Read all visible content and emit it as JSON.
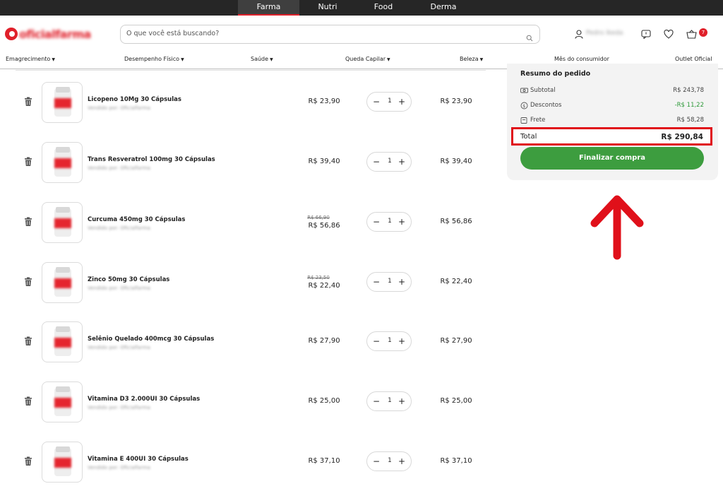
{
  "top_tabs": [
    "Farma",
    "Nutri",
    "Food",
    "Derma"
  ],
  "active_tab": "Farma",
  "logo_text": "oficialfarma",
  "search": {
    "placeholder": "O que você está buscando?"
  },
  "user_name": "Pedro Ikeda",
  "cart_count": "7",
  "categories": [
    "Emagrecimento",
    "Desempenho Físico",
    "Saúde",
    "Queda Capilar",
    "Beleza",
    "Mês do consumidor",
    "Outlet Oficial"
  ],
  "seller_text": "Vendido por: Oficialfarma",
  "items": [
    {
      "name": "Licopeno 10Mg 30 Cápsulas",
      "old_price": "",
      "price": "R$ 23,90",
      "qty": "1",
      "total": "R$ 23,90"
    },
    {
      "name": "Trans Resveratrol 100mg 30 Cápsulas",
      "old_price": "",
      "price": "R$ 39,40",
      "qty": "1",
      "total": "R$ 39,40"
    },
    {
      "name": "Curcuma 450mg 30 Cápsulas",
      "old_price": "R$ 66,90",
      "price": "R$ 56,86",
      "qty": "1",
      "total": "R$ 56,86"
    },
    {
      "name": "Zinco 50mg 30 Cápsulas",
      "old_price": "R$ 23,50",
      "price": "R$ 22,40",
      "qty": "1",
      "total": "R$ 22,40"
    },
    {
      "name": "Selênio Quelado 400mcg 30 Cápsulas",
      "old_price": "",
      "price": "R$ 27,90",
      "qty": "1",
      "total": "R$ 27,90"
    },
    {
      "name": "Vitamina D3 2.000UI 30 Cápsulas",
      "old_price": "",
      "price": "R$ 25,00",
      "qty": "1",
      "total": "R$ 25,00"
    },
    {
      "name": "Vitamina E 400UI 30 Cápsulas",
      "old_price": "",
      "price": "R$ 37,10",
      "qty": "1",
      "total": "R$ 37,10"
    }
  ],
  "summary": {
    "title": "Resumo do pedido",
    "subtotal_label": "Subtotal",
    "subtotal_value": "R$ 243,78",
    "discount_label": "Descontos",
    "discount_value": "-R$ 11,22",
    "shipping_label": "Frete",
    "shipping_value": "R$ 58,28",
    "total_label": "Total",
    "total_value": "R$ 290,84",
    "checkout_label": "Finalizar compra"
  },
  "colors": {
    "brand_red": "#e0202a",
    "checkout_green": "#3d9d3f",
    "discount_green": "#2e9a3a",
    "highlight_red": "#e0101a"
  }
}
